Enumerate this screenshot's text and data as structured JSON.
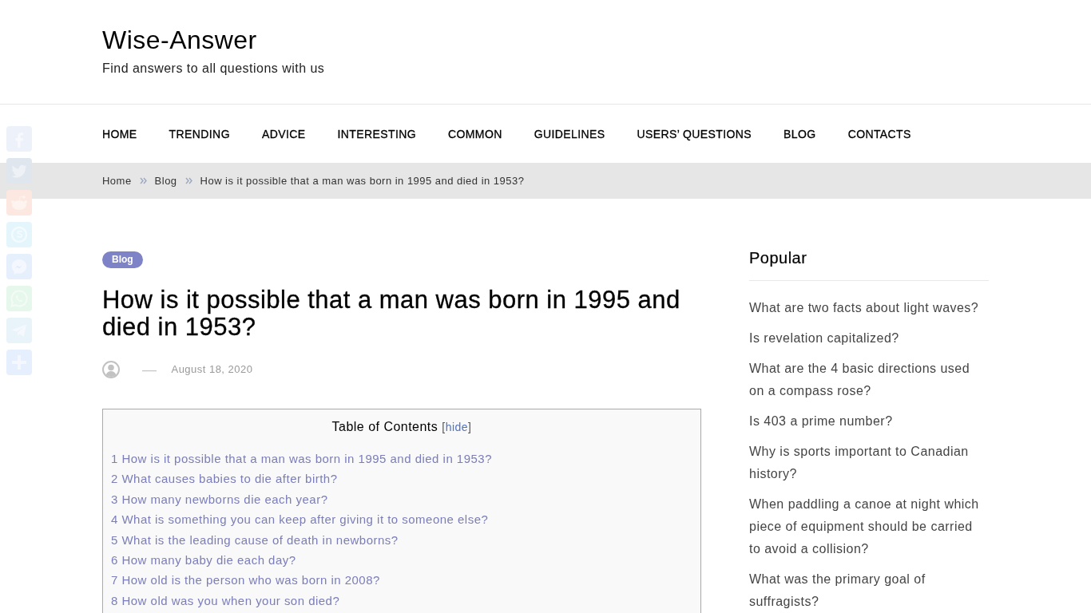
{
  "site": {
    "title": "Wise-Answer",
    "tagline": "Find answers to all questions with us"
  },
  "nav": {
    "items": [
      "HOME",
      "TRENDING",
      "ADVICE",
      "INTERESTING",
      "COMMON",
      "GUIDELINES",
      "USERS’ QUESTIONS",
      "BLOG",
      "CONTACTS"
    ]
  },
  "breadcrumb": {
    "links": [
      "Home",
      "Blog"
    ],
    "current": "How is it possible that a man was born in 1995 and died in 1953?"
  },
  "share_buttons": [
    {
      "kind": "f",
      "color": "#edf1f9"
    },
    {
      "kind": "bird",
      "color": "#dfe6ee"
    },
    {
      "kind": "alien",
      "color": "#fce8e1"
    },
    {
      "kind": "s",
      "color": "#e5f5fc"
    },
    {
      "kind": "chat",
      "color": "#e6f0fd"
    },
    {
      "kind": "phone",
      "color": "#e6f7ec"
    },
    {
      "kind": "plane",
      "color": "#e8f3fa"
    },
    {
      "kind": "plus",
      "color": "#e6effd"
    }
  ],
  "article": {
    "category": "Blog",
    "title": "How is it possible that a man was born in 1995 and died in 1953?",
    "meta": {
      "separator": "—",
      "date": "August 18, 2020"
    },
    "toc": {
      "title": "Table of Contents",
      "toggle": {
        "open": "[",
        "label": "hide",
        "close": "]"
      },
      "items": [
        "1 How is it possible that a man was born in 1995 and died in 1953?",
        "2 What causes babies to die after birth?",
        "3 How many newborns die each year?",
        "4 What is something you can keep after giving it to someone else?",
        "5 What is the leading cause of death in newborns?",
        "6 How many baby die each day?",
        "7 How old is the person who was born in 2008?",
        "8 How old was you when your son died?"
      ]
    }
  },
  "sidebar": {
    "title": "Popular",
    "items": [
      "What are two facts about light waves?",
      "Is revelation capitalized?",
      "What are the 4 basic directions used on a compass rose?",
      "Is 403 a prime number?",
      "Why is sports important to Canadian history?",
      "When paddling a canoe at night which piece of equipment should be carried to avoid a collision?",
      "What was the primary goal of suffragists?"
    ]
  }
}
